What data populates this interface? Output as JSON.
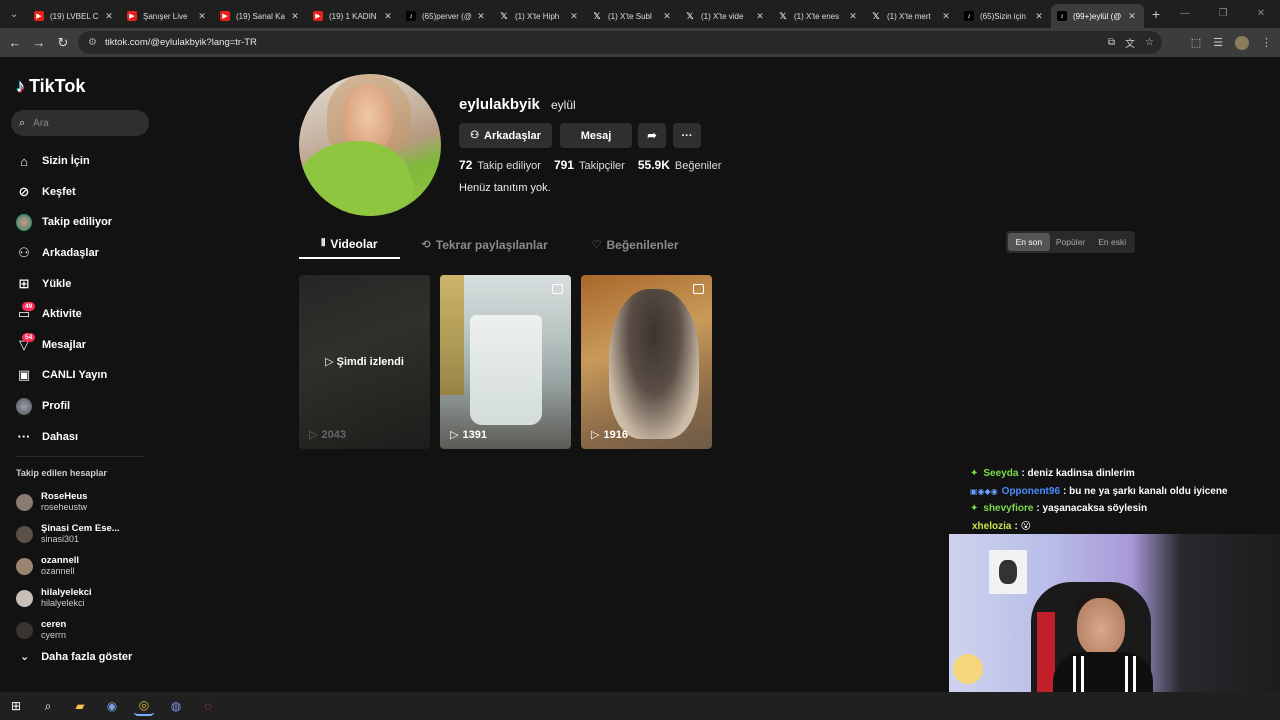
{
  "browser": {
    "tabs": [
      {
        "type": "yt",
        "title": "(19) LVBEL C"
      },
      {
        "type": "yt",
        "title": "Şanışer Live"
      },
      {
        "type": "yt",
        "title": "(19) Sanal Ka"
      },
      {
        "type": "yt",
        "title": "(19) 1 KADIN"
      },
      {
        "type": "tt",
        "title": "(65)perver (@"
      },
      {
        "type": "x",
        "title": "(1) X'te Hiph"
      },
      {
        "type": "x",
        "title": "(1) X'te Subl"
      },
      {
        "type": "x",
        "title": "(1) X'te vide"
      },
      {
        "type": "x",
        "title": "(1) X'te enes"
      },
      {
        "type": "x",
        "title": "(1) X'te mert"
      },
      {
        "type": "tt",
        "title": "(65)Sizin için"
      },
      {
        "type": "tt",
        "title": "(99+)eylül (@",
        "active": true
      }
    ],
    "url": "tiktok.com/@eylulakbyik?lang=tr-TR"
  },
  "sidebar": {
    "brand": "TikTok",
    "search_placeholder": "Ara",
    "nav": [
      {
        "label": "Sizin İçin",
        "icon": "home-icon"
      },
      {
        "label": "Keşfet",
        "icon": "compass-icon"
      },
      {
        "label": "Takip ediliyor",
        "icon": "following-avatar"
      },
      {
        "label": "Arkadaşlar",
        "icon": "friends-icon"
      },
      {
        "label": "Yükle",
        "icon": "upload-icon"
      },
      {
        "label": "Aktivite",
        "icon": "activity-icon",
        "badge": "49"
      },
      {
        "label": "Mesajlar",
        "icon": "messages-icon",
        "badge": "54"
      },
      {
        "label": "CANLI Yayın",
        "icon": "live-icon"
      },
      {
        "label": "Profil",
        "icon": "profile-avatar"
      },
      {
        "label": "Dahası",
        "icon": "more-icon"
      }
    ],
    "following_title": "Takip edilen hesaplar",
    "accounts": [
      {
        "name": "RoseHeus",
        "user": "roseheustw",
        "color": "#8a7a70"
      },
      {
        "name": "Şinasi  Cem  Ese...",
        "user": "sinasi301",
        "color": "#5a5048"
      },
      {
        "name": "ozannell",
        "user": "ozannell",
        "color": "#9a8470"
      },
      {
        "name": "hilalyelekci",
        "user": "hilalyelekci",
        "color": "#c8c0b8"
      },
      {
        "name": "ceren",
        "user": "cyerrn",
        "color": "#3a3430"
      }
    ],
    "show_more": "Daha fazla göster"
  },
  "profile": {
    "username": "eylulakbyik",
    "nickname": "eylül",
    "buttons": {
      "friends": "Arkadaşlar",
      "message": "Mesaj"
    },
    "stats": [
      {
        "value": "72",
        "label": "Takip ediliyor"
      },
      {
        "value": "791",
        "label": "Takipçiler"
      },
      {
        "value": "55.9K",
        "label": "Beğeniler"
      }
    ],
    "bio": "Henüz tanıtım yok.",
    "tabs": {
      "videos": "Videolar",
      "reposts": "Tekrar paylaşılanlar",
      "liked": "Beğenilenler"
    },
    "sort": {
      "latest": "En son",
      "popular": "Popüler",
      "oldest": "En eski"
    },
    "videos": [
      {
        "views": "2043",
        "watched": "Şimdi izlendi"
      },
      {
        "views": "1391"
      },
      {
        "views": "1916"
      }
    ]
  },
  "chat": [
    {
      "user": "Seeyda",
      "color": "#7ddc4c",
      "msg": ": deniz kadinsa dinlerim",
      "sym": "✦"
    },
    {
      "user": "Opponent96",
      "color": "#4a8cff",
      "msg": ": bu ne ya şarkı kanalı oldu iyicene",
      "badges": "▣◉◆◉"
    },
    {
      "user": "shevyfiore",
      "color": "#7ddc4c",
      "msg": ": yaşanacaksa söylesin",
      "sym": "✦"
    },
    {
      "user": "xhelozia",
      "color": "#c8e84c",
      "msg": ": 😮"
    }
  ]
}
